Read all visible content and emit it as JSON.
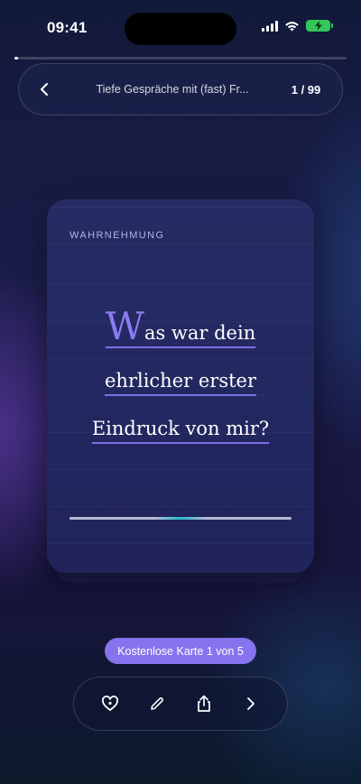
{
  "status_bar": {
    "time": "09:41"
  },
  "progress": {
    "current_fraction": 0.01
  },
  "header": {
    "deck_title": "Tiefe Gespräche mit (fast) Fr...",
    "counter": "1 / 99"
  },
  "card": {
    "category": "WAHRNEHMUNG",
    "question_first_letter": "W",
    "question_line1_rest": "as war dein",
    "question_line2": "ehrlicher erster",
    "question_line3": "Eindruck von mir?"
  },
  "badge": {
    "label": "Kostenlose Karte 1 von 5"
  },
  "toolbar": {
    "icons": [
      "heart-icon",
      "pencil-icon",
      "share-icon",
      "chevron-right-icon"
    ]
  },
  "colors": {
    "accent": "#8574ee",
    "card_bg": "#242a62",
    "battery": "#34c759"
  }
}
